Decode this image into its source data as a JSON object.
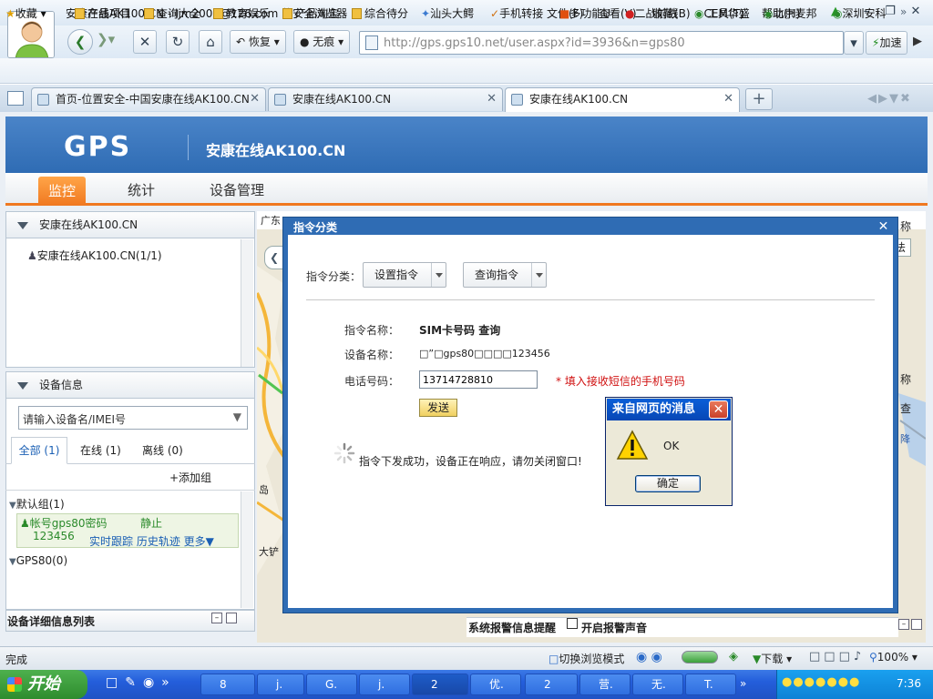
{
  "window": {
    "title": "安康在线AK100.CN - ljm2009@126.com 的安全浏览器",
    "menu": [
      "文件(F)",
      "查看(V)",
      "收藏(B)",
      "工具(T)",
      "帮助(H)"
    ]
  },
  "nav": {
    "restore_label": "恢复",
    "trace_label": "无痕",
    "url": "http://gps.gps10.net/user.aspx?id=3936&n=gps80",
    "speed_label": "加速"
  },
  "bookmarks": {
    "favorites_label": "收藏",
    "items": [
      "产品项目",
      "查询大全",
      "教育娱乐",
      "产品淘宝",
      "综合待分",
      "汕头大鳄",
      "手机转接",
      "多功能U",
      "二战前线",
      "CEM华盛",
      "北京麦邦",
      "深圳安科"
    ]
  },
  "tabs": [
    {
      "label": "首页-位置安全-中国安康在线AK100.CN"
    },
    {
      "label": "安康在线AK100.CN"
    },
    {
      "label": "安康在线AK100.CN"
    }
  ],
  "header": {
    "logo": "GPS",
    "site_name": "安康在线AK100.CN",
    "nav": [
      "监控",
      "统计",
      "设备管理"
    ]
  },
  "left_panel": {
    "tree_title": "安康在线AK100.CN",
    "tree_item": "安康在线AK100.CN(1/1)",
    "device_info_title": "设备信息",
    "search_placeholder": "请输入设备名/IMEI号",
    "filter_tabs": [
      "全部 (1)",
      "在线 (1)",
      "离线 (0)"
    ],
    "add_group": "+添加组",
    "group_default": "默认组(1)",
    "device_name": "帐号gps80密码",
    "device_pwd": "123456",
    "device_status": "静止",
    "device_links": "实时跟踪 历史轨迹 更多▼",
    "group_gps80": "GPS80(0)",
    "detail_list_title": "设备详细信息列表"
  },
  "map": {
    "top_text": "广东",
    "label_island": "岛",
    "label_dayu": "大铲",
    "label_lsze": "称",
    "label_fa": "法",
    "label_cha": "查",
    "label_jiang": "降",
    "alarm_label": "系统报警信息提醒",
    "alarm_sound_label": "开启报警声音"
  },
  "dialog": {
    "title": "指令分类",
    "category_label": "指令分类：",
    "set_cmd": "设置指令",
    "query_cmd": "查询指令",
    "cmd_name_label": "指令名称：",
    "cmd_name_value": "SIM卡号码 查询",
    "device_name_label": "设备名称：",
    "device_name_value": "□”□gps80□□□□123456",
    "phone_label": "电话号码：",
    "phone_value": "13714728810",
    "phone_hint": "* 填入接收短信的手机号码",
    "send_label": "发送",
    "status_msg": "指令下发成功，设备正在响应，请勿关闭窗口!"
  },
  "alert": {
    "title": "来自网页的消息",
    "message": "OK",
    "ok_label": "确定"
  },
  "statusbar": {
    "left": "完成",
    "mode": "切换浏览模式",
    "download": "下载",
    "zoom": "100%"
  },
  "taskbar": {
    "start": "开始",
    "tasks": [
      "8",
      "j.",
      "G.",
      "j.",
      "2",
      "优.",
      "2",
      "营.",
      "无.",
      "T."
    ],
    "time": "7:36"
  }
}
